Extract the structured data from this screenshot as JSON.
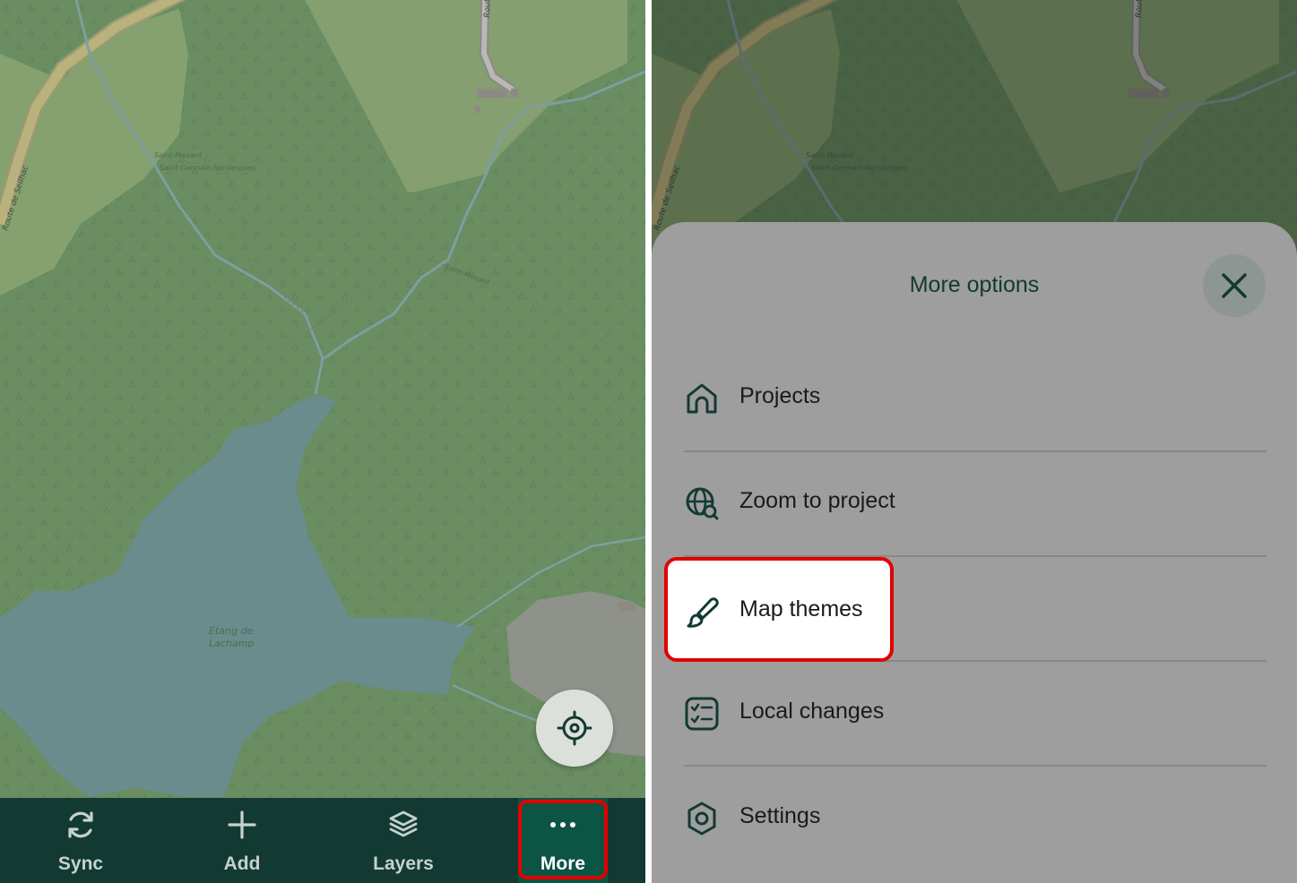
{
  "map": {
    "labels": [
      "Saint-Mexant",
      "Saint-Germain-les-Vergnes",
      "Saint-Mexant",
      "Route de Seilhac",
      "Route",
      "Étang de",
      "Lachamp"
    ]
  },
  "toolbar": {
    "items": [
      {
        "label": "Sync",
        "icon": "sync-icon"
      },
      {
        "label": "Add",
        "icon": "plus-icon"
      },
      {
        "label": "Layers",
        "icon": "layers-icon"
      },
      {
        "label": "More",
        "icon": "more-dots-icon"
      }
    ]
  },
  "sheet": {
    "title": "More options",
    "items": [
      {
        "label": "Projects",
        "icon": "home-icon"
      },
      {
        "label": "Zoom to project",
        "icon": "globe-search-icon"
      },
      {
        "label": "Map themes",
        "icon": "paintbrush-icon"
      },
      {
        "label": "Local changes",
        "icon": "checklist-icon"
      },
      {
        "label": "Settings",
        "icon": "settings-icon"
      }
    ]
  },
  "colors": {
    "toolbar_bg": "#123a32",
    "accent": "#0c5444",
    "highlight": "#e20000",
    "forest": "#6a8d62",
    "meadow": "#85a06f",
    "water": "#6a8c8d"
  }
}
